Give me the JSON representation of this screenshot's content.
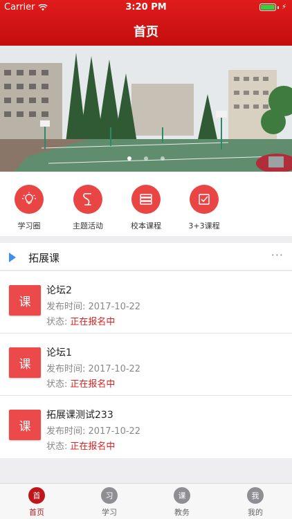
{
  "status": {
    "carrier": "Carrier",
    "time": "3:20 PM"
  },
  "nav": {
    "title": "首页"
  },
  "banner": {
    "pages": 3,
    "active_page": 1
  },
  "quick_links": [
    {
      "label": "学习圈",
      "icon": "lightbulb-icon"
    },
    {
      "label": "主题活动",
      "icon": "theme-activity-icon"
    },
    {
      "label": "校本课程",
      "icon": "books-icon"
    },
    {
      "label": "3+3课程",
      "icon": "checklist-icon"
    }
  ],
  "section": {
    "title": "拓展课",
    "more": "···"
  },
  "courses": [
    {
      "badge": "课",
      "title": "论坛2",
      "date_label": "发布时间:",
      "date": "2017-10-22",
      "status_label": "状态:",
      "status": "正在报名中"
    },
    {
      "badge": "课",
      "title": "论坛1",
      "date_label": "发布时间:",
      "date": "2017-10-22",
      "status_label": "状态:",
      "status": "正在报名中"
    },
    {
      "badge": "课",
      "title": "拓展课测试233",
      "date_label": "发布时间:",
      "date": "2017-10-22",
      "status_label": "状态:",
      "status": "正在报名中"
    }
  ],
  "tabs": [
    {
      "icon_text": "首",
      "label": "首页",
      "active": true
    },
    {
      "icon_text": "习",
      "label": "学习",
      "active": false
    },
    {
      "icon_text": "课",
      "label": "教务",
      "active": false
    },
    {
      "icon_text": "我",
      "label": "我的",
      "active": false
    }
  ],
  "colors": {
    "brand_red": "#d31515",
    "accent_red": "#e94545",
    "status_red": "#e02020",
    "section_blue": "#3d8ff2"
  }
}
